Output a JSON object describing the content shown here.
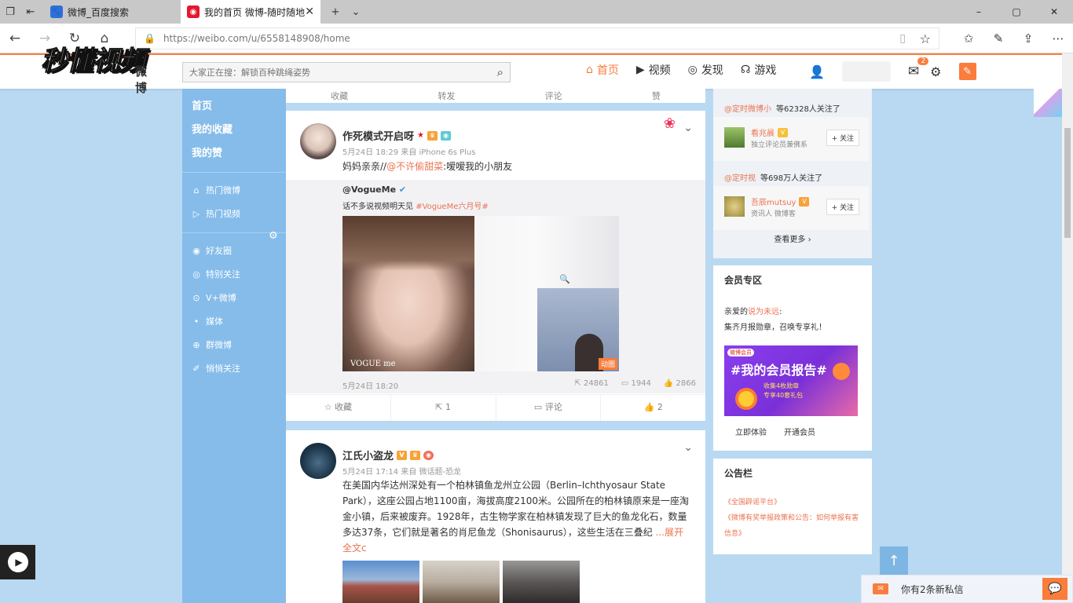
{
  "browser": {
    "tabs": [
      {
        "title": "微博_百度搜索",
        "favicon": "baidu-paw-icon"
      },
      {
        "title": "我的首页 微博-随时随地",
        "favicon": "weibo-icon"
      }
    ],
    "url": "https://weibo.com/u/6558148908/home",
    "window_controls": [
      "–",
      "▢",
      "✕"
    ]
  },
  "overlay": {
    "watermark": "秒懂视频"
  },
  "header": {
    "logo_text": "微博",
    "search_placeholder": "大家正在搜：解锁百种跳绳姿势",
    "nav": [
      {
        "label": "首页",
        "icon": "home-icon"
      },
      {
        "label": "视频",
        "icon": "video-icon"
      },
      {
        "label": "发现",
        "icon": "compass-icon"
      },
      {
        "label": "游戏",
        "icon": "gamepad-icon"
      }
    ],
    "message_count": "2"
  },
  "sidebar": {
    "main": [
      "首页",
      "我的收藏",
      "我的赞"
    ],
    "sub1": [
      {
        "label": "热门微博",
        "icon": "fire-icon"
      },
      {
        "label": "热门视频",
        "icon": "play-icon"
      }
    ],
    "sub2": [
      {
        "label": "好友圈",
        "icon": "circle-icon"
      },
      {
        "label": "特别关注",
        "icon": "star-icon"
      },
      {
        "label": "V+微博",
        "icon": "v-icon"
      },
      {
        "label": "媒体",
        "icon": "dot-icon"
      },
      {
        "label": "群微博",
        "icon": "group-icon"
      },
      {
        "label": "悄悄关注",
        "icon": "eye-icon"
      }
    ]
  },
  "feed": {
    "top_actions": [
      "收藏",
      "转发",
      "评论",
      "赞"
    ],
    "post1": {
      "author": "作死模式开启呀",
      "meta": "5月24日 18:29 来自 iPhone 6s Plus",
      "text_prefix": "妈妈亲亲//",
      "text_mention": "@不许偷甜菜",
      "text_suffix": ":嗳嗳我的小朋友",
      "repost": {
        "author": "@VogueMe",
        "text": "话不多说视频明天见",
        "mention": "#VogueMe六月号#",
        "video_watermark": "VOGUE me",
        "gif_label": "动图",
        "time": "5月24日 18:20",
        "shares": "24861",
        "comments": "1944",
        "likes": "2866"
      },
      "actions": [
        "收藏",
        "1",
        "评论",
        "2"
      ]
    },
    "post2": {
      "author": "江氏小盗龙",
      "meta": "5月24日 17:14 来自 微话题-恐龙",
      "body": "在美国内华达州深处有一个柏林镇鱼龙州立公园（Berlin–Ichthyosaur State Park），这座公园占地1100亩，海拔高度2100米。公园所在的柏林镇原来是一座淘金小镇，后来被废弃。1928年，古生物学家在柏林镇发现了巨大的鱼龙化石，数量多达37条，它们就是著名的肖尼鱼龙（Shonisaurus），这些生活在三叠纪",
      "more": "...展开全文c"
    }
  },
  "right": {
    "follows": [
      {
        "mention": "@定时微博小",
        "text": "等62328人关注了"
      },
      {
        "mention": "@定时视",
        "text": "等698万人关注了"
      }
    ],
    "suggestions": [
      {
        "name": "看兆晨",
        "desc": "独立评论员兼佛系",
        "button": "+ 关注"
      },
      {
        "name": "吾辰mutsuy",
        "desc": "资讯人 微博客",
        "button": "+ 关注"
      }
    ],
    "more": "查看更多 ›",
    "vip": {
      "title": "会员专区",
      "greet_prefix": "亲爱的",
      "greet_name": "说为未远",
      "greet_suffix": ":",
      "line2": "集齐月报勋章，召唤专享礼！",
      "banner_brand": "微博会员",
      "banner_title": "#我的会员报告#",
      "banner_sub1": "收集4枚勋章",
      "banner_sub2": "专享40套礼包",
      "btn1": "立即体验",
      "btn2": "开通会员"
    },
    "notice": {
      "title": "公告栏",
      "items": [
        "《全国辟谣平台》",
        "《微博有奖举报政策和公告：如何举报有害",
        "信息》"
      ]
    }
  },
  "chat": {
    "message": "你有2条新私信"
  },
  "colors": {
    "accent": "#fa7d3c",
    "mention": "#eb7350",
    "sidebar": "#85bcea",
    "bg": "#b8d9f1"
  }
}
